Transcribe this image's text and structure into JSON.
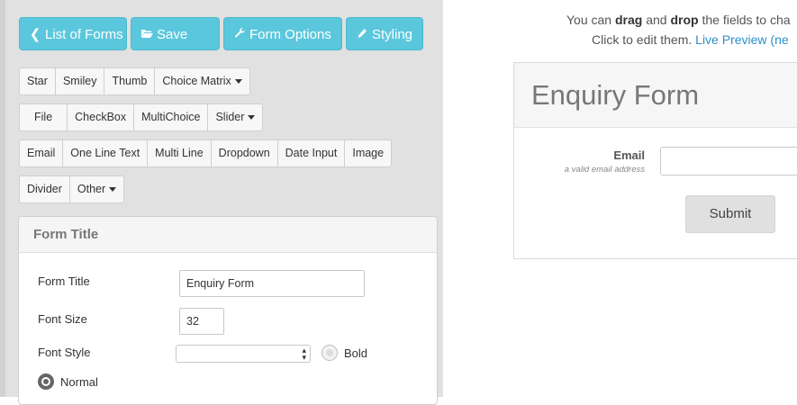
{
  "toolbar": {
    "list_forms": "List of Forms",
    "save": "Save",
    "form_options": "Form Options",
    "styling": "Styling"
  },
  "field_rows": {
    "row1": [
      "Star",
      "Smiley",
      "Thumb",
      "Choice Matrix"
    ],
    "row2": [
      "File",
      "CheckBox",
      "MultiChoice",
      "Slider"
    ],
    "row3": [
      "Email",
      "One Line Text",
      "Multi Line",
      "Dropdown",
      "Date Input",
      "Image"
    ],
    "row4": [
      "Divider",
      "Other"
    ]
  },
  "settings_panel": {
    "title": "Form Title",
    "form_title_label": "Form Title",
    "form_title_value": "Enquiry Form",
    "font_size_label": "Font Size",
    "font_size_value": "32",
    "font_style_label": "Font Style",
    "font_style_value": "",
    "bold_label": "Bold",
    "normal_label": "Normal"
  },
  "hint": {
    "line1_a": "You can ",
    "line1_drag": "drag",
    "line1_and": " and ",
    "line1_drop": "drop",
    "line1_b": " the fields to cha",
    "line2_a": "Click to edit them. ",
    "line2_link": "Live Preview (ne"
  },
  "preview": {
    "form_title": "Enquiry Form",
    "email_label": "Email",
    "email_help": "a valid email address",
    "submit": "Submit"
  },
  "colors": {
    "toolbar_button": "#5bc7dc",
    "left_background": "#e1e1e1",
    "link": "#2a8fc7"
  }
}
